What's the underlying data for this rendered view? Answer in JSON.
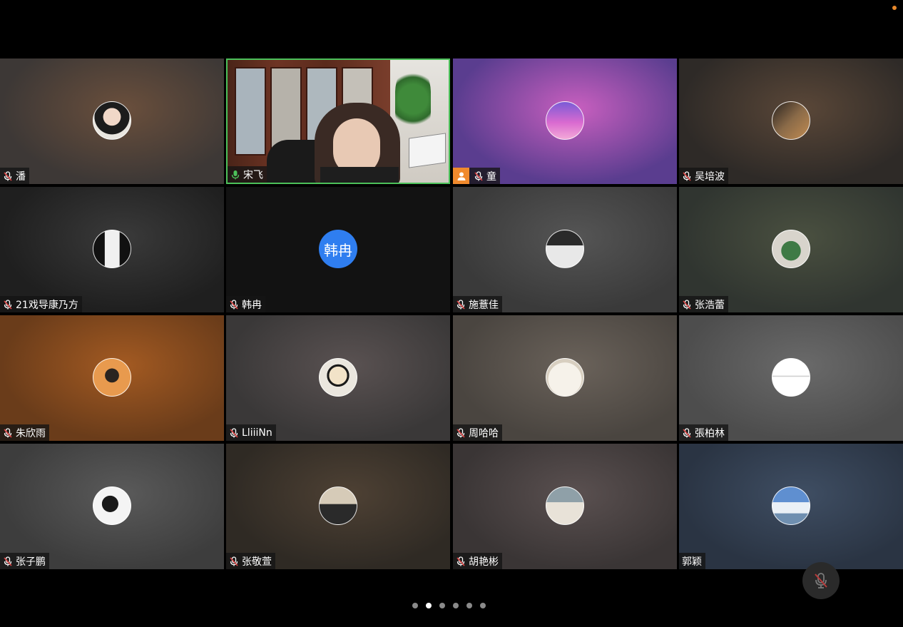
{
  "participants": [
    {
      "name": "潘",
      "muted": true,
      "avatar": "woman-illustration-avatar",
      "bg": "#3d3836",
      "accent": "#6a4f3c"
    },
    {
      "name": "宋飞",
      "muted": false,
      "avatar": "camera-video",
      "bg": "#bdb6ae",
      "accent": "#7a4432",
      "active": true
    },
    {
      "name": "童",
      "muted": true,
      "avatar": "dolphin-sunset-avatar",
      "bg": "#5a3d8f",
      "accent": "#c85fbf",
      "host": true
    },
    {
      "name": "吴培波",
      "muted": true,
      "avatar": "street-photo-avatar",
      "bg": "#2e2a27",
      "accent": "#5a4738"
    },
    {
      "name": "21戏导康乃方",
      "muted": true,
      "avatar": "calligraphy-avatar",
      "bg": "#1f1f1f",
      "accent": "#3a3a3a"
    },
    {
      "name": "韩冉",
      "muted": true,
      "avatar": "text",
      "avatar_text": "韩冉",
      "bg": "#121212",
      "accent": "#121212"
    },
    {
      "name": "施薏佳",
      "muted": true,
      "avatar": "screen-avatar",
      "bg": "#3a3a3a",
      "accent": "#555555"
    },
    {
      "name": "张浩蕾",
      "muted": true,
      "avatar": "cactus-avatar",
      "bg": "#303530",
      "accent": "#4a5040"
    },
    {
      "name": "朱欣雨",
      "muted": true,
      "avatar": "orange-illustration-avatar",
      "bg": "#6a3c1a",
      "accent": "#a35a22"
    },
    {
      "name": "LliiiNn",
      "muted": true,
      "avatar": "cartoon-girl-avatar",
      "bg": "#3a3838",
      "accent": "#5a5252"
    },
    {
      "name": "周哈哈",
      "muted": true,
      "avatar": "dog-avatar",
      "bg": "#4a4540",
      "accent": "#6a625a"
    },
    {
      "name": "張柏林",
      "muted": true,
      "avatar": "fish-sketch-avatar",
      "bg": "#4d4d4d",
      "accent": "#6a6a6a"
    },
    {
      "name": "张子鹏",
      "muted": true,
      "avatar": "dragon-sketch-avatar",
      "bg": "#3d3d3d",
      "accent": "#5a5a5a"
    },
    {
      "name": "张敬萱",
      "muted": true,
      "avatar": "person-photo-avatar",
      "bg": "#2f2a24",
      "accent": "#4e4134"
    },
    {
      "name": "胡艳彬",
      "muted": true,
      "avatar": "group-photo-avatar",
      "bg": "#3a3535",
      "accent": "#5a5050"
    },
    {
      "name": "郭颖",
      "muted": false,
      "avatar": "cloud-sky-avatar",
      "bg": "#2a3443",
      "accent": "#3f4e63"
    }
  ],
  "pager": {
    "count": 6,
    "current": 1
  },
  "colors": {
    "active_border": "#4cc15a",
    "host_badge": "#f08a2d",
    "avatar_blue": "#2f7ef0"
  }
}
